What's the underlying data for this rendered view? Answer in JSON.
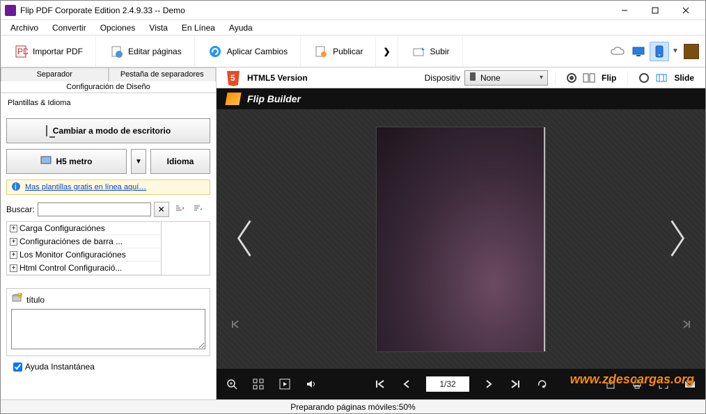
{
  "window": {
    "title": "Flip PDF Corporate Edition 2.4.9.33 -- Demo"
  },
  "menu": [
    "Archivo",
    "Convertir",
    "Opciones",
    "Vista",
    "En Línea",
    "Ayuda"
  ],
  "toolbar": {
    "import": "Importar PDF",
    "edit": "Editar páginas",
    "apply": "Aplicar Cambios",
    "publish": "Publicar",
    "upload": "Subir"
  },
  "sidebar": {
    "tab_separator": "Separador",
    "tab_pestana": "Pestaña de separadores",
    "tab_header": "Configuración de Diseño",
    "section_plantillas": "Plantillas & Idioma",
    "btn_desktop": "Cambiar a modo de escritorio",
    "sel_h5": "H5 metro",
    "btn_idioma": "Idioma",
    "link_more": "Mas plantillas gratis en línea aquí…",
    "search_label": "Buscar:",
    "tree": [
      "Carga Configuraciónes",
      "Configuraciónes de barra ...",
      "Los Monitor Configuraciónes",
      "Html Control Configuració..."
    ],
    "prop_label": "título",
    "help_chk": "Ayuda Instantánea"
  },
  "preview": {
    "html5_label": "HTML5 Version",
    "device_label": "Dispositiv",
    "device_value": "None",
    "mode_flip": "Flip",
    "mode_slide": "Slide",
    "brand": "Flip Builder",
    "page_indicator": "1/32"
  },
  "status": "Preparando páginas móviles:50%",
  "watermark": "www.zdescargas.org"
}
